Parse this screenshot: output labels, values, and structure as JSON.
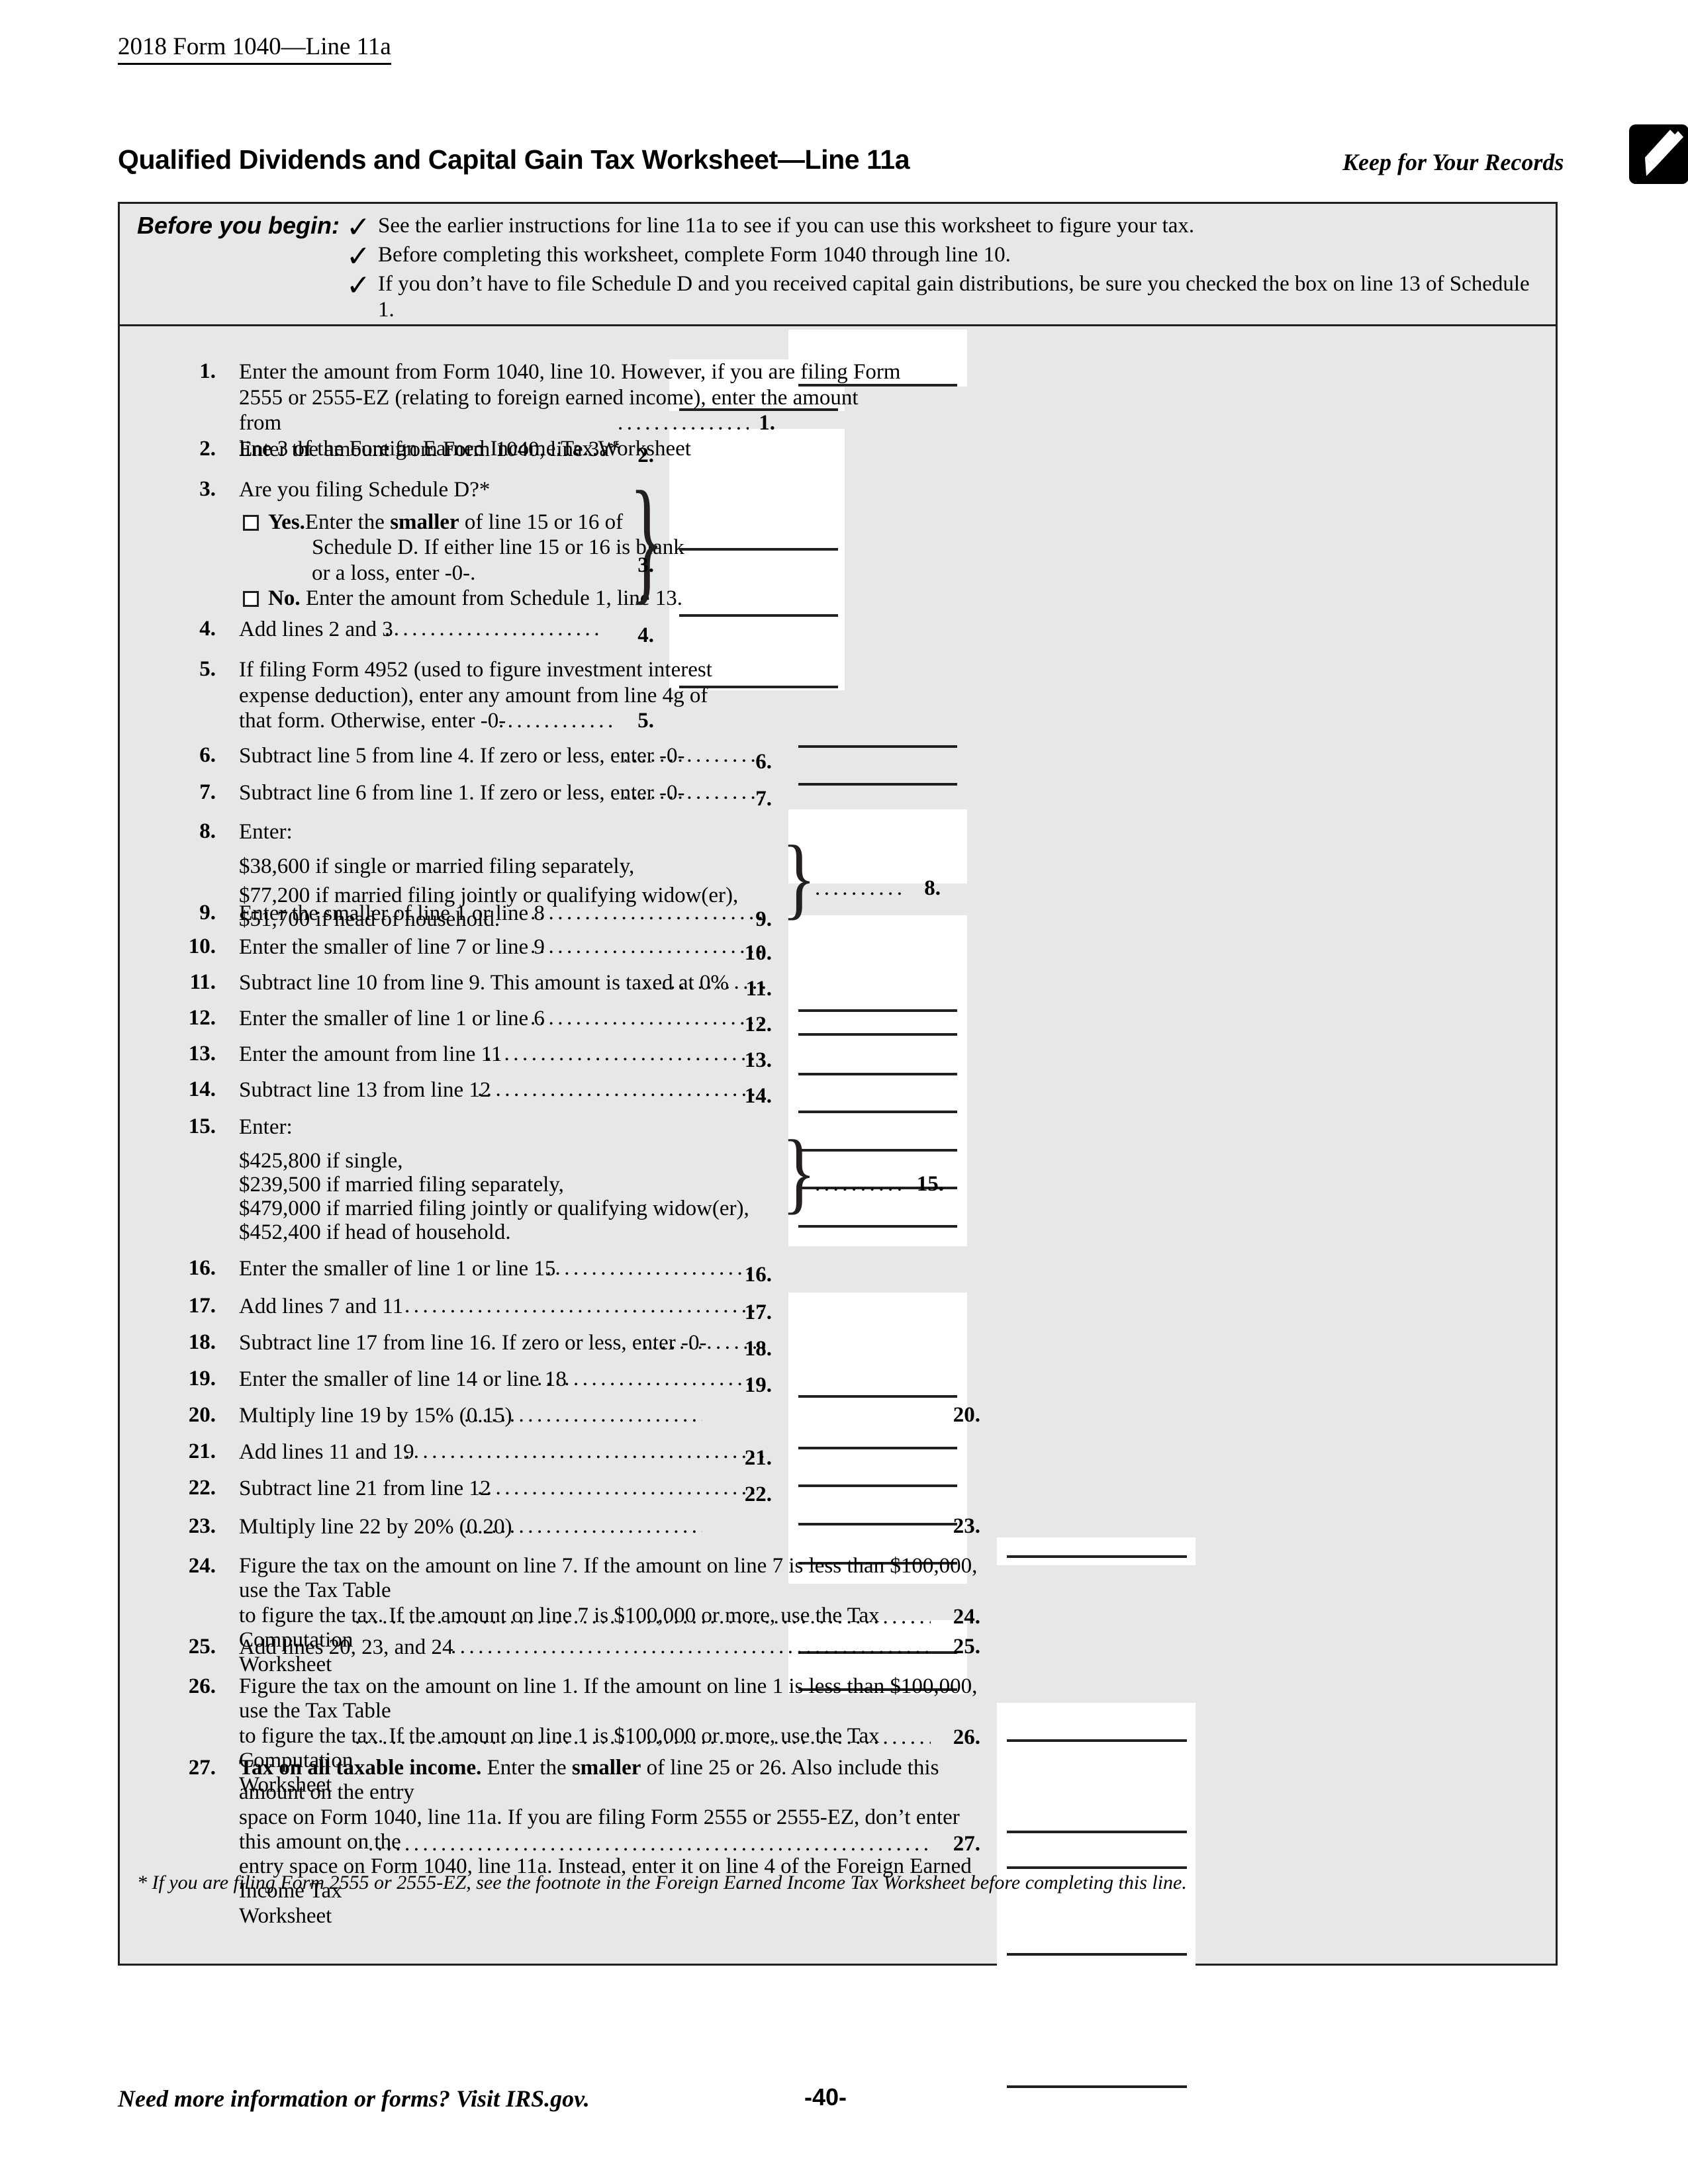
{
  "header": {
    "form_reference": "2018 Form 1040—Line 11a"
  },
  "title_row": {
    "worksheet_title": "Qualified Dividends and Capital Gain Tax Worksheet—Line 11a",
    "keep_for_records": "Keep for Your Records",
    "pencil_icon": "pencil-icon"
  },
  "before_you_begin": {
    "label": "Before you begin:",
    "check_glyph": "✓",
    "items": [
      "See the earlier instructions for line 11a to see if you can use this worksheet to figure your tax.",
      "Before completing this worksheet, complete Form 1040 through line 10.",
      "If you don’t have to file Schedule D and you received capital gain distributions, be sure you checked the box on line 13 of Schedule 1."
    ]
  },
  "lines": {
    "l1": {
      "num": "1.",
      "text_1": "Enter the amount from Form 1040, line 10. However, if you are filing Form",
      "text_2": "2555 or 2555-EZ (relating to foreign earned income), enter the amount from",
      "text_3": "line 3 of the Foreign Earned Income Tax Worksheet",
      "answer_num": "1."
    },
    "l2": {
      "num": "2.",
      "text": "Enter the amount from Form 1040, line 3a*",
      "answer_num": "2."
    },
    "l3": {
      "num": "3.",
      "question": "Are you filing Schedule D?*",
      "yes_label": "Yes.",
      "yes_text_1_a": "Enter the ",
      "yes_text_1_b": "smaller",
      "yes_text_1_c": " of line 15 or 16 of",
      "yes_text_2": "Schedule D. If either line 15 or 16 is blank",
      "yes_text_3": "or a loss, enter -0-.",
      "no_label": "No.",
      "no_text": "Enter the amount from Schedule 1, line 13.",
      "answer_num": "3."
    },
    "l4": {
      "num": "4.",
      "text": "Add lines 2 and 3",
      "answer_num": "4."
    },
    "l5": {
      "num": "5.",
      "text_1": "If filing Form 4952 (used to figure investment interest",
      "text_2": "expense deduction), enter any amount from line 4g of",
      "text_3": "that form. Otherwise, enter -0-",
      "answer_num": "5."
    },
    "l6": {
      "num": "6.",
      "text": "Subtract line 5 from line 4. If zero or less, enter -0-",
      "answer_num": "6."
    },
    "l7": {
      "num": "7.",
      "text": "Subtract line 6 from line 1. If zero or less, enter -0-",
      "answer_num": "7."
    },
    "l8": {
      "num": "8.",
      "text": "Enter:",
      "opt_1": "$38,600 if single or married filing separately,",
      "opt_2": "$77,200 if married filing jointly or qualifying widow(er),",
      "opt_3": "$51,700 if head of household.",
      "answer_num": "8."
    },
    "l9": {
      "num": "9.",
      "text": "Enter the smaller of line 1 or line 8",
      "answer_num": "9."
    },
    "l10": {
      "num": "10.",
      "text": "Enter the smaller of line 7 or line 9",
      "answer_num": "10."
    },
    "l11": {
      "num": "11.",
      "text": "Subtract line 10 from line 9. This amount is taxed at 0%",
      "answer_num": "11."
    },
    "l12": {
      "num": "12.",
      "text": "Enter the smaller of line 1 or line 6",
      "answer_num": "12."
    },
    "l13": {
      "num": "13.",
      "text": "Enter the amount from line 11",
      "answer_num": "13."
    },
    "l14": {
      "num": "14.",
      "text": "Subtract line 13 from line 12",
      "answer_num": "14."
    },
    "l15": {
      "num": "15.",
      "text": "Enter:",
      "opt_1": "$425,800 if single,",
      "opt_2": "$239,500 if married filing separately,",
      "opt_3": "$479,000 if married filing jointly or qualifying widow(er),",
      "opt_4": "$452,400 if head of household.",
      "answer_num": "15."
    },
    "l16": {
      "num": "16.",
      "text": "Enter the smaller of line 1 or line 15",
      "answer_num": "16."
    },
    "l17": {
      "num": "17.",
      "text": "Add lines 7 and 11",
      "answer_num": "17."
    },
    "l18": {
      "num": "18.",
      "text": "Subtract line 17 from line 16. If zero or less, enter -0-",
      "answer_num": "18."
    },
    "l19": {
      "num": "19.",
      "text": "Enter the smaller of line 14 or line 18",
      "answer_num": "19."
    },
    "l20": {
      "num": "20.",
      "text": "Multiply line 19 by 15% (0.15)",
      "answer_num": "20."
    },
    "l21": {
      "num": "21.",
      "text": "Add lines 11 and 19",
      "answer_num": "21."
    },
    "l22": {
      "num": "22.",
      "text": "Subtract line 21 from line 12",
      "answer_num": "22."
    },
    "l23": {
      "num": "23.",
      "text": "Multiply line 22 by 20% (0.20)",
      "answer_num": "23."
    },
    "l24": {
      "num": "24.",
      "text_1": "Figure the tax on the amount on line 7. If the amount on line 7 is less than $100,000, use the Tax Table",
      "text_2": "to figure the tax. If the amount on line 7 is $100,000 or more, use the Tax Computation",
      "text_3": "Worksheet",
      "answer_num": "24."
    },
    "l25": {
      "num": "25.",
      "text": "Add lines 20, 23, and 24",
      "answer_num": "25."
    },
    "l26": {
      "num": "26.",
      "text_1": "Figure the tax on the amount on line 1. If the amount on line 1 is less than $100,000, use the Tax Table",
      "text_2": "to figure the tax. If the amount on line 1 is $100,000 or more, use the Tax Computation",
      "text_3": "Worksheet",
      "answer_num": "26."
    },
    "l27": {
      "num": "27.",
      "text_1_a": "Tax on all taxable income.",
      "text_1_b": " Enter the ",
      "text_1_c": "smaller",
      "text_1_d": " of line 25 or 26. Also include this amount on the entry",
      "text_2": "space on Form 1040, line 11a. If you are filing Form 2555 or 2555-EZ, don’t enter this amount on the",
      "text_3": "entry space on Form 1040, line 11a. Instead, enter it on line 4 of the Foreign Earned Income Tax",
      "text_4": "Worksheet",
      "answer_num": "27."
    }
  },
  "footnote": "* If you are filing Form 2555 or 2555-EZ, see the footnote in the Foreign Earned Income Tax Worksheet before completing this line.",
  "footer": {
    "info": "Need more information or forms? Visit IRS.gov.",
    "page_number": "-40-"
  },
  "colors": {
    "panel_background": "#e6e7e8",
    "border": "#231f20",
    "answer_box": "#ffffff",
    "text": "#000000"
  }
}
